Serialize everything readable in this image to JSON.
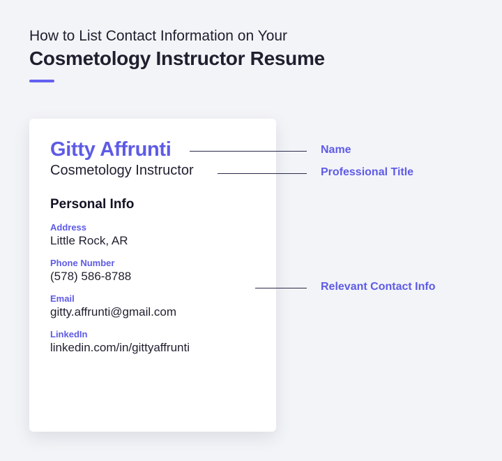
{
  "heading": {
    "line1": "How to List Contact Information on Your",
    "line2": "Cosmetology Instructor Resume"
  },
  "resume": {
    "name": "Gitty Affrunti",
    "title": "Cosmetology Instructor",
    "section_header": "Personal Info",
    "fields": {
      "address_label": "Address",
      "address_value": "Little Rock, AR",
      "phone_label": "Phone Number",
      "phone_value": "(578) 586-8788",
      "email_label": "Email",
      "email_value": "gitty.affrunti@gmail.com",
      "linkedin_label": "LinkedIn",
      "linkedin_value": "linkedin.com/in/gittyaffrunti"
    }
  },
  "annotations": {
    "name": "Name",
    "title": "Professional Title",
    "contact": "Relevant Contact Info"
  }
}
